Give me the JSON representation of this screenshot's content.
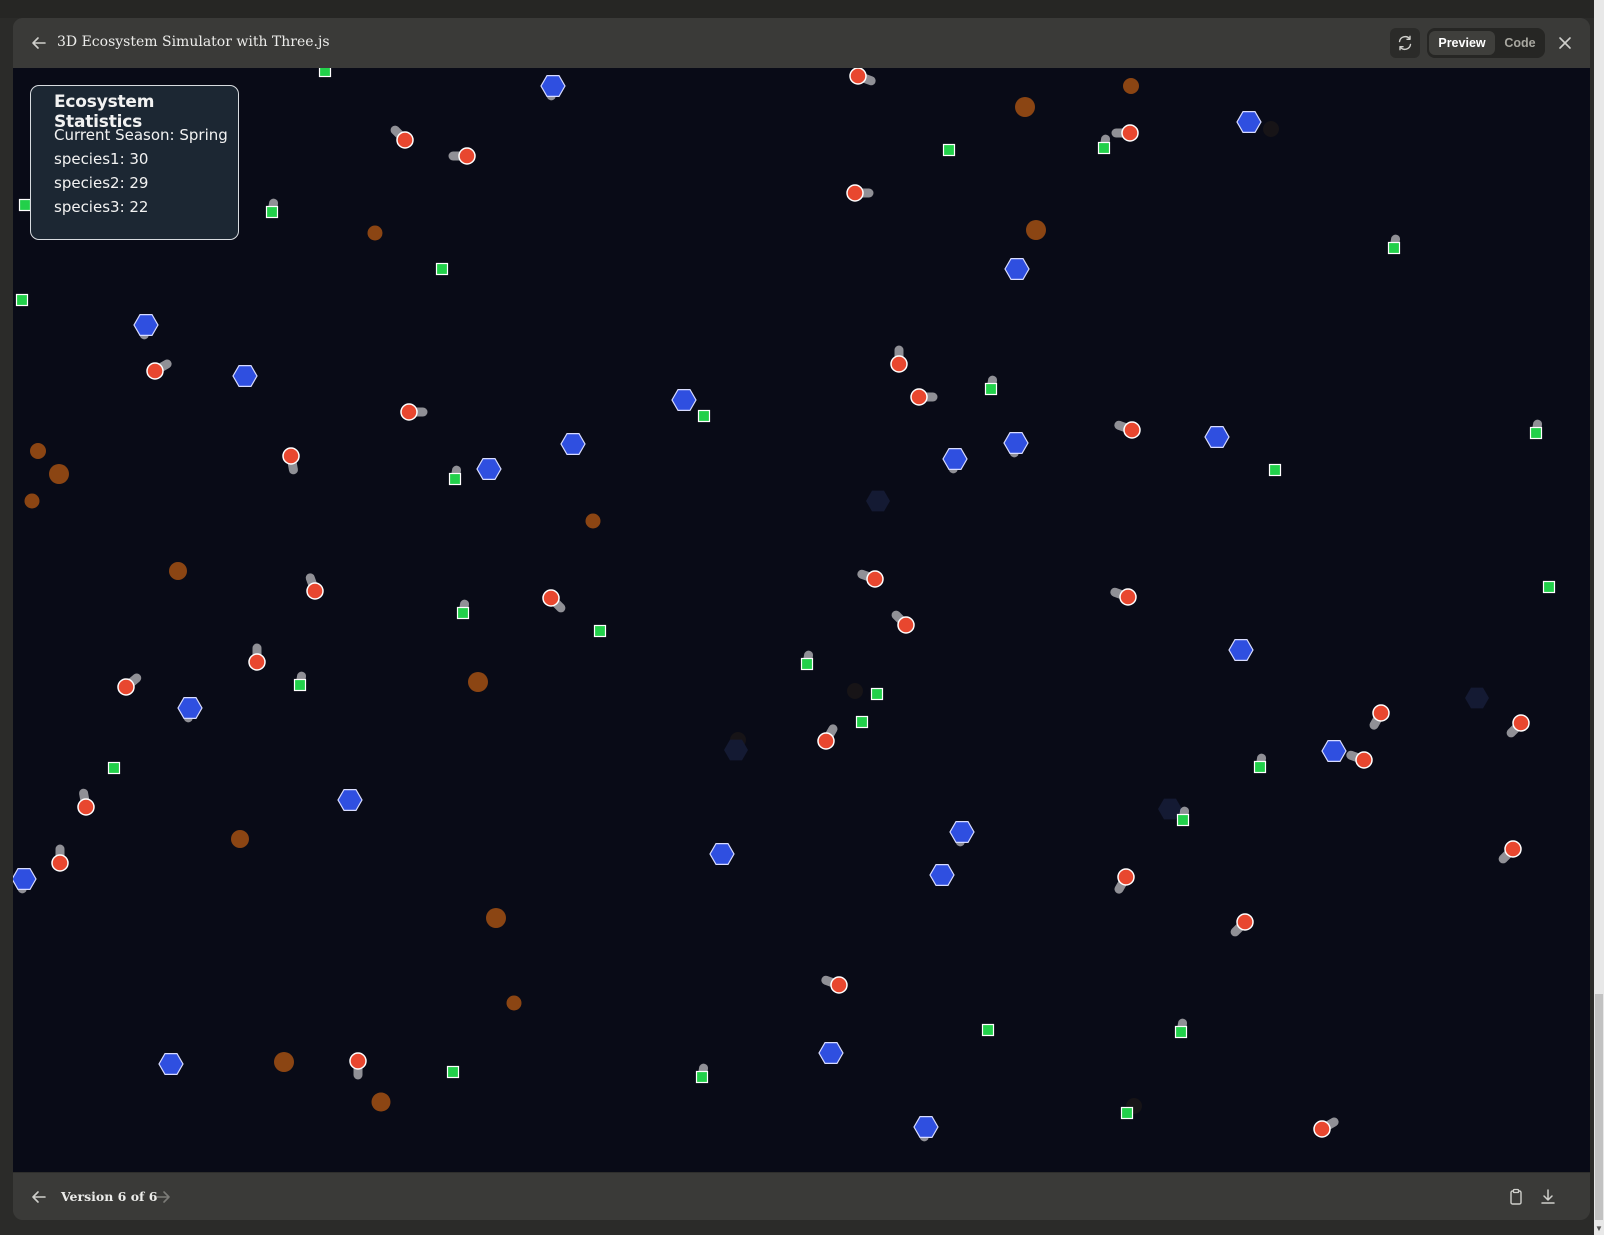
{
  "window": {
    "title": "3D Ecosystem Simulator with Three.js",
    "tabs": {
      "preview": "Preview",
      "code": "Code"
    }
  },
  "stats": {
    "heading": "Ecosystem Statistics",
    "season": "Current Season: Spring",
    "species1": "species1: 30",
    "species2": "species2: 29",
    "species3": "species3: 22"
  },
  "footer": {
    "version": "Version 6 of 6"
  },
  "icons": {
    "back": "arrow-left-icon",
    "refresh": "refresh-icon",
    "close": "close-icon",
    "prev": "arrow-left-icon",
    "next": "arrow-right-icon",
    "copy": "clipboard-icon",
    "download": "download-icon"
  },
  "colors": {
    "canvas_bg": "#090b17",
    "species1": "#e8472f",
    "species2": "#2f4fe0",
    "species3": "#22d04a",
    "food": "#8b4513"
  }
}
